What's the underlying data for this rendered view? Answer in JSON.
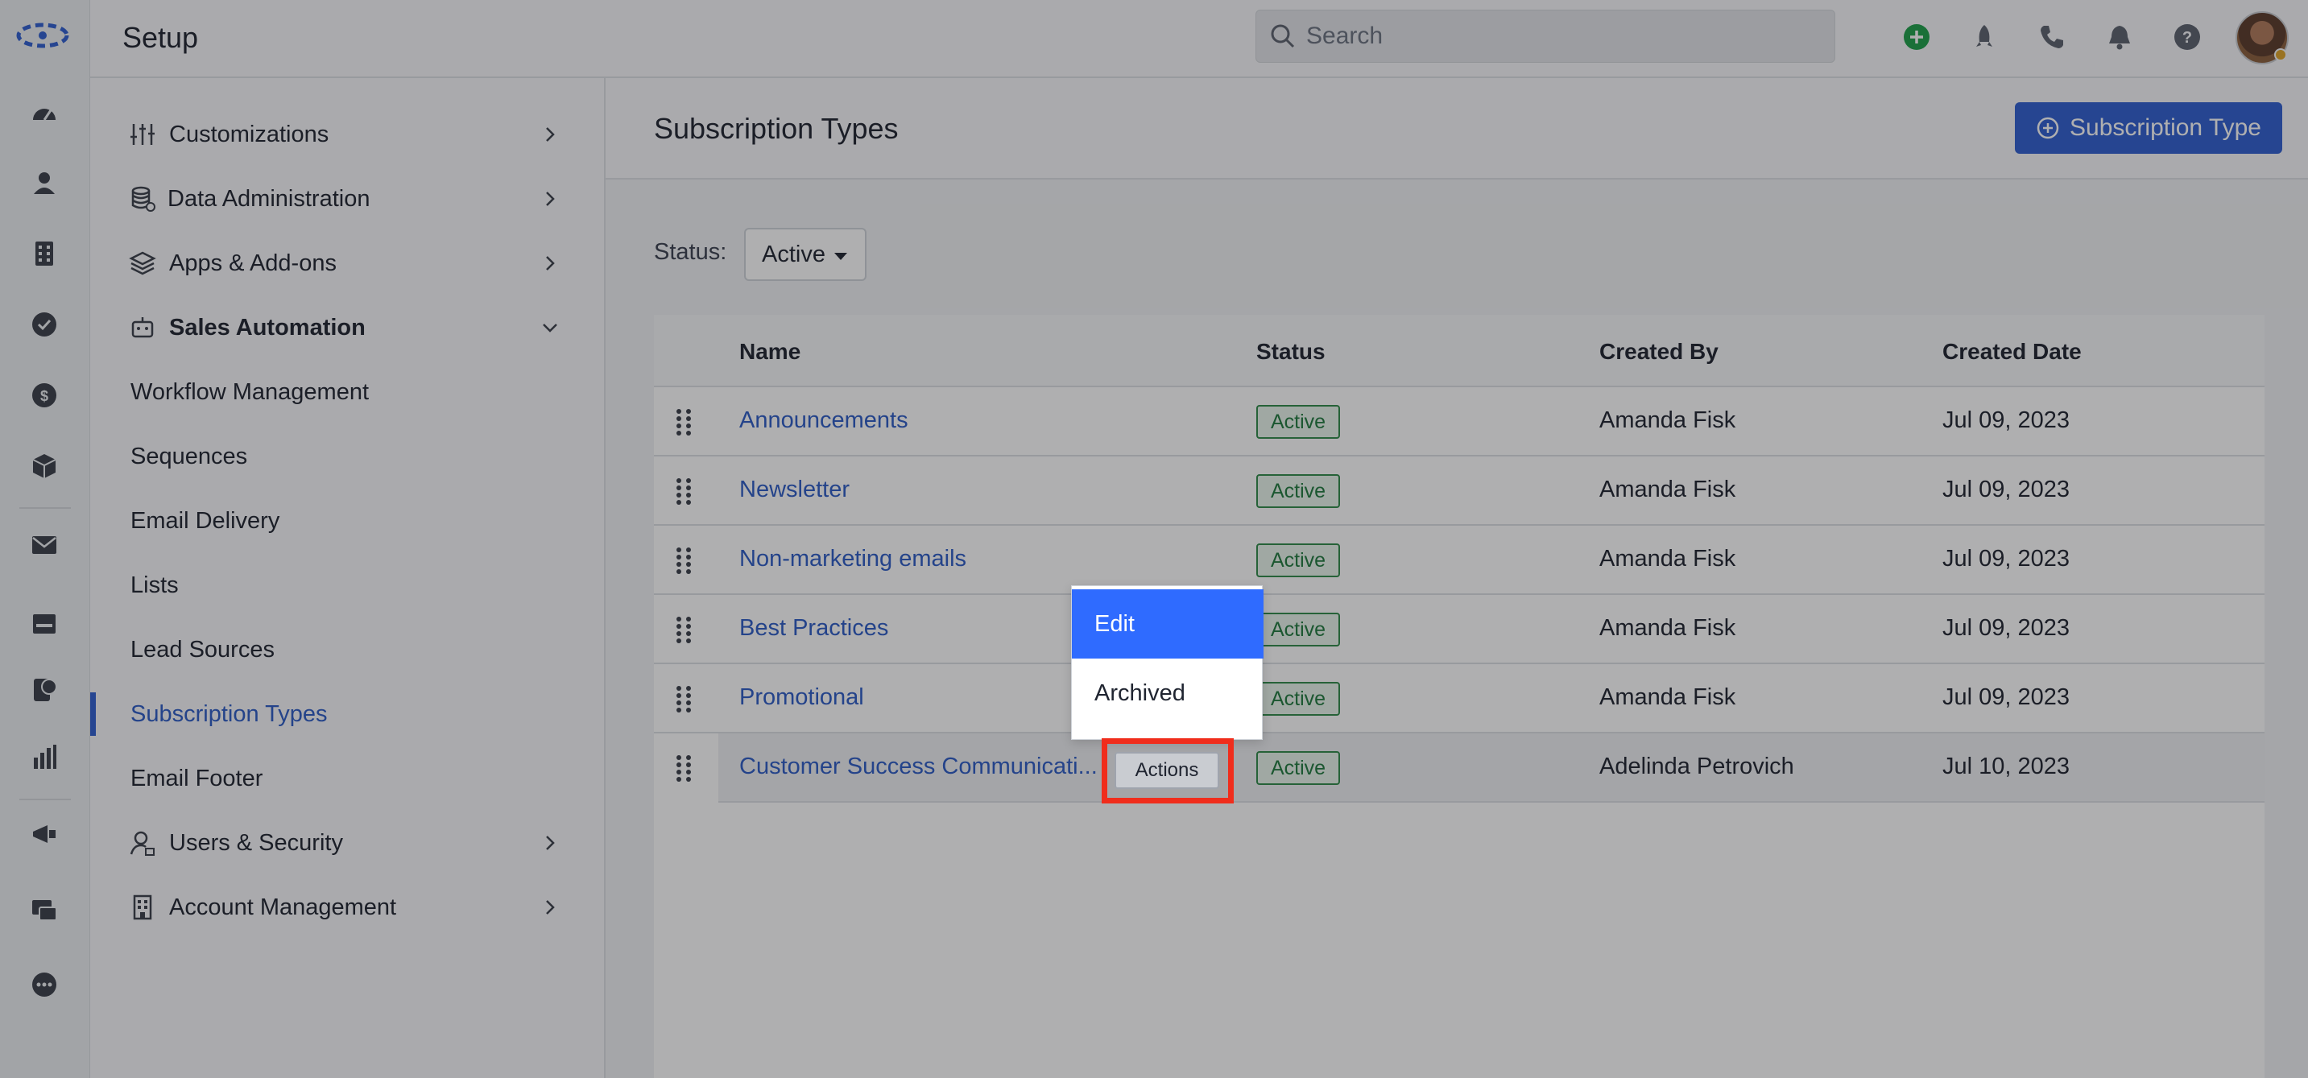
{
  "header": {
    "title": "Setup",
    "search_placeholder": "Search"
  },
  "nav": {
    "items": [
      {
        "label": "Customizations"
      },
      {
        "label": "Data Administration"
      },
      {
        "label": "Apps & Add-ons"
      },
      {
        "label": "Sales Automation"
      },
      {
        "label": "Workflow Management"
      },
      {
        "label": "Sequences"
      },
      {
        "label": "Email Delivery"
      },
      {
        "label": "Lists"
      },
      {
        "label": "Lead Sources"
      },
      {
        "label": "Subscription Types"
      },
      {
        "label": "Email Footer"
      },
      {
        "label": "Users & Security"
      },
      {
        "label": "Account Management"
      }
    ],
    "active": "Subscription Types"
  },
  "page": {
    "title": "Subscription Types",
    "add_button": "Subscription Type",
    "status_label": "Status:",
    "status_value": "Active"
  },
  "table": {
    "columns": [
      "Name",
      "Status",
      "Created By",
      "Created Date"
    ],
    "rows": [
      {
        "name": "Announcements",
        "status": "Active",
        "created_by": "Amanda Fisk",
        "created_date": "Jul 09, 2023"
      },
      {
        "name": "Newsletter",
        "status": "Active",
        "created_by": "Amanda Fisk",
        "created_date": "Jul 09, 2023"
      },
      {
        "name": "Non-marketing emails",
        "status": "Active",
        "created_by": "Amanda Fisk",
        "created_date": "Jul 09, 2023"
      },
      {
        "name": "Best Practices",
        "status": "Active",
        "created_by": "Amanda Fisk",
        "created_date": "Jul 09, 2023"
      },
      {
        "name": "Promotional",
        "status": "Active",
        "created_by": "Amanda Fisk",
        "created_date": "Jul 09, 2023"
      },
      {
        "name": "Customer Success Communicati...",
        "status": "Active",
        "created_by": "Adelinda Petrovich",
        "created_date": "Jul 10, 2023"
      }
    ],
    "actions_label": "Actions"
  },
  "menu": {
    "items": [
      "Edit",
      "Archived"
    ]
  },
  "colors": {
    "accent": "#2f5fd0",
    "menu_selected": "#2f6bff",
    "status_green": "#1f7a3e",
    "highlight": "#f02d1c"
  }
}
